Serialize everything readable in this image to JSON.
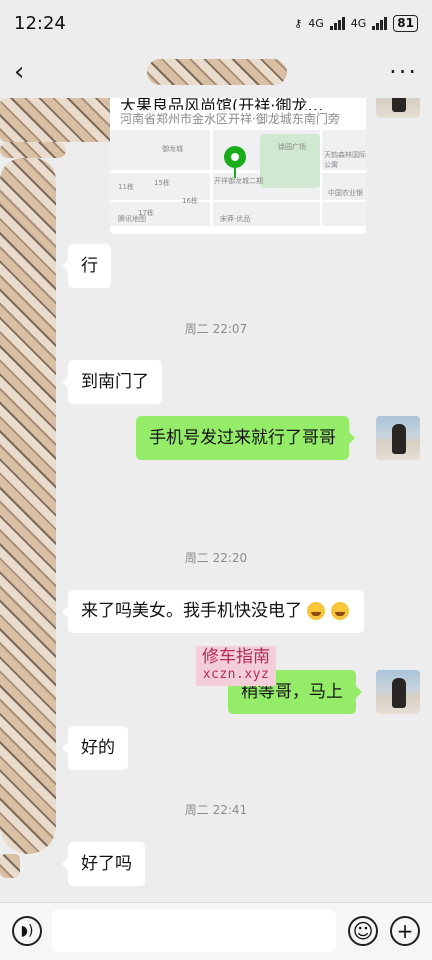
{
  "status_bar": {
    "time": "12:24",
    "network_1": "4G",
    "network_2": "4G",
    "battery": "81"
  },
  "nav": {
    "back_icon": "chevron-left-icon",
    "more_label": "···"
  },
  "location_card": {
    "title": "大果良品风尚馆(开祥·御龙…",
    "address": "河南省郑州市金水区开祥·御龙城东南门旁",
    "map_labels": [
      "御龙城",
      "15栋",
      "11栋",
      "16栋",
      "17栋",
      "开祥御龙城二期",
      "徐园广场",
      "天韵森林国际公寓",
      "中国农业银",
      "腾讯地图",
      "宋莽·优品"
    ]
  },
  "messages": [
    {
      "side": "in",
      "text": "行"
    },
    {
      "type": "time",
      "text": "周二 22:07"
    },
    {
      "side": "in",
      "text": "到南门了"
    },
    {
      "side": "out",
      "text": "手机号发过来就行了哥哥"
    },
    {
      "type": "time",
      "text": "周二 22:20"
    },
    {
      "side": "in",
      "text": "来了吗美女。我手机快没电了"
    },
    {
      "side": "out",
      "text": "稍等哥，马上"
    },
    {
      "side": "in",
      "text": "好的"
    },
    {
      "type": "time",
      "text": "周二 22:41"
    },
    {
      "side": "in",
      "text": "好了吗"
    }
  ],
  "watermark": {
    "line1": "修车指南",
    "line2": "xczn.xyz"
  },
  "input_bar": {
    "voice_icon": "voice-icon",
    "emoji_icon": "emoji-icon",
    "plus_label": "+"
  }
}
